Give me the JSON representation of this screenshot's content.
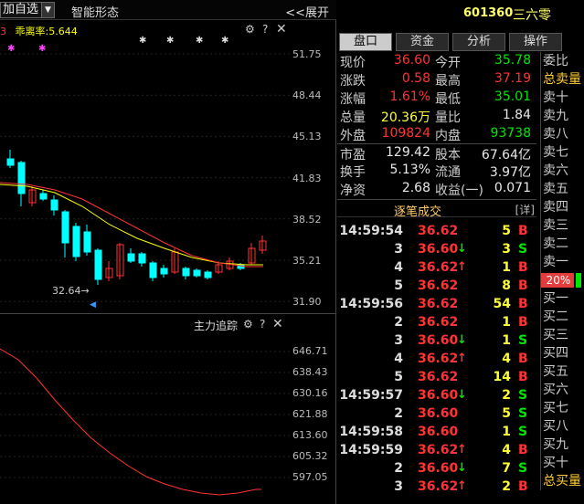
{
  "toolbar": {
    "add_favorite": "加自选",
    "smart_shape": "智能形态",
    "expand": "<<展开"
  },
  "indicator1": {
    "label": "乖离率:5.644",
    "prefix": "3"
  },
  "price_axis": [
    "51.75",
    "48.44",
    "45.13",
    "41.83",
    "38.52",
    "35.21",
    "31.90"
  ],
  "low_marker": "32.64",
  "pane2": {
    "title": "主力追踪",
    "axis": [
      "646.71",
      "638.43",
      "630.16",
      "621.88",
      "613.60",
      "605.32",
      "597.05"
    ]
  },
  "stock": {
    "code": "601360",
    "name": "三六零"
  },
  "tabs": [
    "盘口",
    "资金",
    "分析",
    "操作"
  ],
  "quote_rows": [
    {
      "l1": "现价",
      "v1": "36.60",
      "c1": "red",
      "l2": "今开",
      "v2": "35.78",
      "c2": "green"
    },
    {
      "l1": "涨跌",
      "v1": "0.58",
      "c1": "red",
      "l2": "最高",
      "v2": "37.19",
      "c2": "red"
    },
    {
      "l1": "涨幅",
      "v1": "1.61%",
      "c1": "red",
      "l2": "最低",
      "v2": "35.01",
      "c2": "green"
    },
    {
      "l1": "总量",
      "v1": "20.36万",
      "c1": "yellow",
      "l2": "量比",
      "v2": "1.84",
      "c2": "white"
    },
    {
      "l1": "外盘",
      "v1": "109824",
      "c1": "red",
      "l2": "内盘",
      "v2": "93738",
      "c2": "green"
    },
    {
      "l1": "市盈",
      "v1": "129.42",
      "c1": "white",
      "l2": "股本",
      "v2": "67.64亿",
      "c2": "white"
    },
    {
      "l1": "换手",
      "v1": "5.13%",
      "c1": "white",
      "l2": "流通",
      "v2": "3.97亿",
      "c2": "white"
    },
    {
      "l1": "净资",
      "v1": "2.68",
      "c1": "white",
      "l2": "收益(一)",
      "v2": "0.071",
      "c2": "white"
    }
  ],
  "order_book": [
    "委比",
    "总卖量",
    "卖十",
    "卖九",
    "卖八",
    "卖七",
    "卖六",
    "卖五",
    "卖四",
    "卖三",
    "卖二",
    "卖一",
    "20%",
    "买一",
    "买二",
    "买三",
    "买四",
    "买五",
    "买六",
    "买七",
    "买八",
    "买九",
    "买十",
    "总买量"
  ],
  "ticks_header": {
    "title": "逐笔成交",
    "detail": "[详]"
  },
  "ticks": [
    {
      "time": "14:59:54",
      "price": "36.62",
      "arrow": "",
      "vol": "5",
      "bs": "B"
    },
    {
      "time": "3",
      "price": "36.60",
      "arrow": "↓",
      "vol": "3",
      "bs": "S"
    },
    {
      "time": "4",
      "price": "36.62",
      "arrow": "↑",
      "vol": "1",
      "bs": "B"
    },
    {
      "time": "5",
      "price": "36.62",
      "arrow": "",
      "vol": "8",
      "bs": "B"
    },
    {
      "time": "14:59:56",
      "price": "36.62",
      "arrow": "",
      "vol": "54",
      "bs": "B"
    },
    {
      "time": "2",
      "price": "36.62",
      "arrow": "",
      "vol": "1",
      "bs": "B"
    },
    {
      "time": "3",
      "price": "36.60",
      "arrow": "↓",
      "vol": "1",
      "bs": "S"
    },
    {
      "time": "4",
      "price": "36.62",
      "arrow": "↑",
      "vol": "4",
      "bs": "B"
    },
    {
      "time": "5",
      "price": "36.62",
      "arrow": "",
      "vol": "14",
      "bs": "B"
    },
    {
      "time": "14:59:57",
      "price": "36.60",
      "arrow": "↓",
      "vol": "2",
      "bs": "S"
    },
    {
      "time": "2",
      "price": "36.60",
      "arrow": "",
      "vol": "5",
      "bs": "S"
    },
    {
      "time": "14:59:58",
      "price": "36.60",
      "arrow": "",
      "vol": "1",
      "bs": "S"
    },
    {
      "time": "14:59:59",
      "price": "36.62",
      "arrow": "↑",
      "vol": "4",
      "bs": "B"
    },
    {
      "time": "2",
      "price": "36.60",
      "arrow": "↓",
      "vol": "7",
      "bs": "S"
    },
    {
      "time": "3",
      "price": "36.62",
      "arrow": "↑",
      "vol": "2",
      "bs": "B"
    }
  ],
  "colors": {
    "up": "#ff3333",
    "down": "#00e600",
    "cyan": "#00ffff",
    "yellow_line": "#ffff00"
  }
}
